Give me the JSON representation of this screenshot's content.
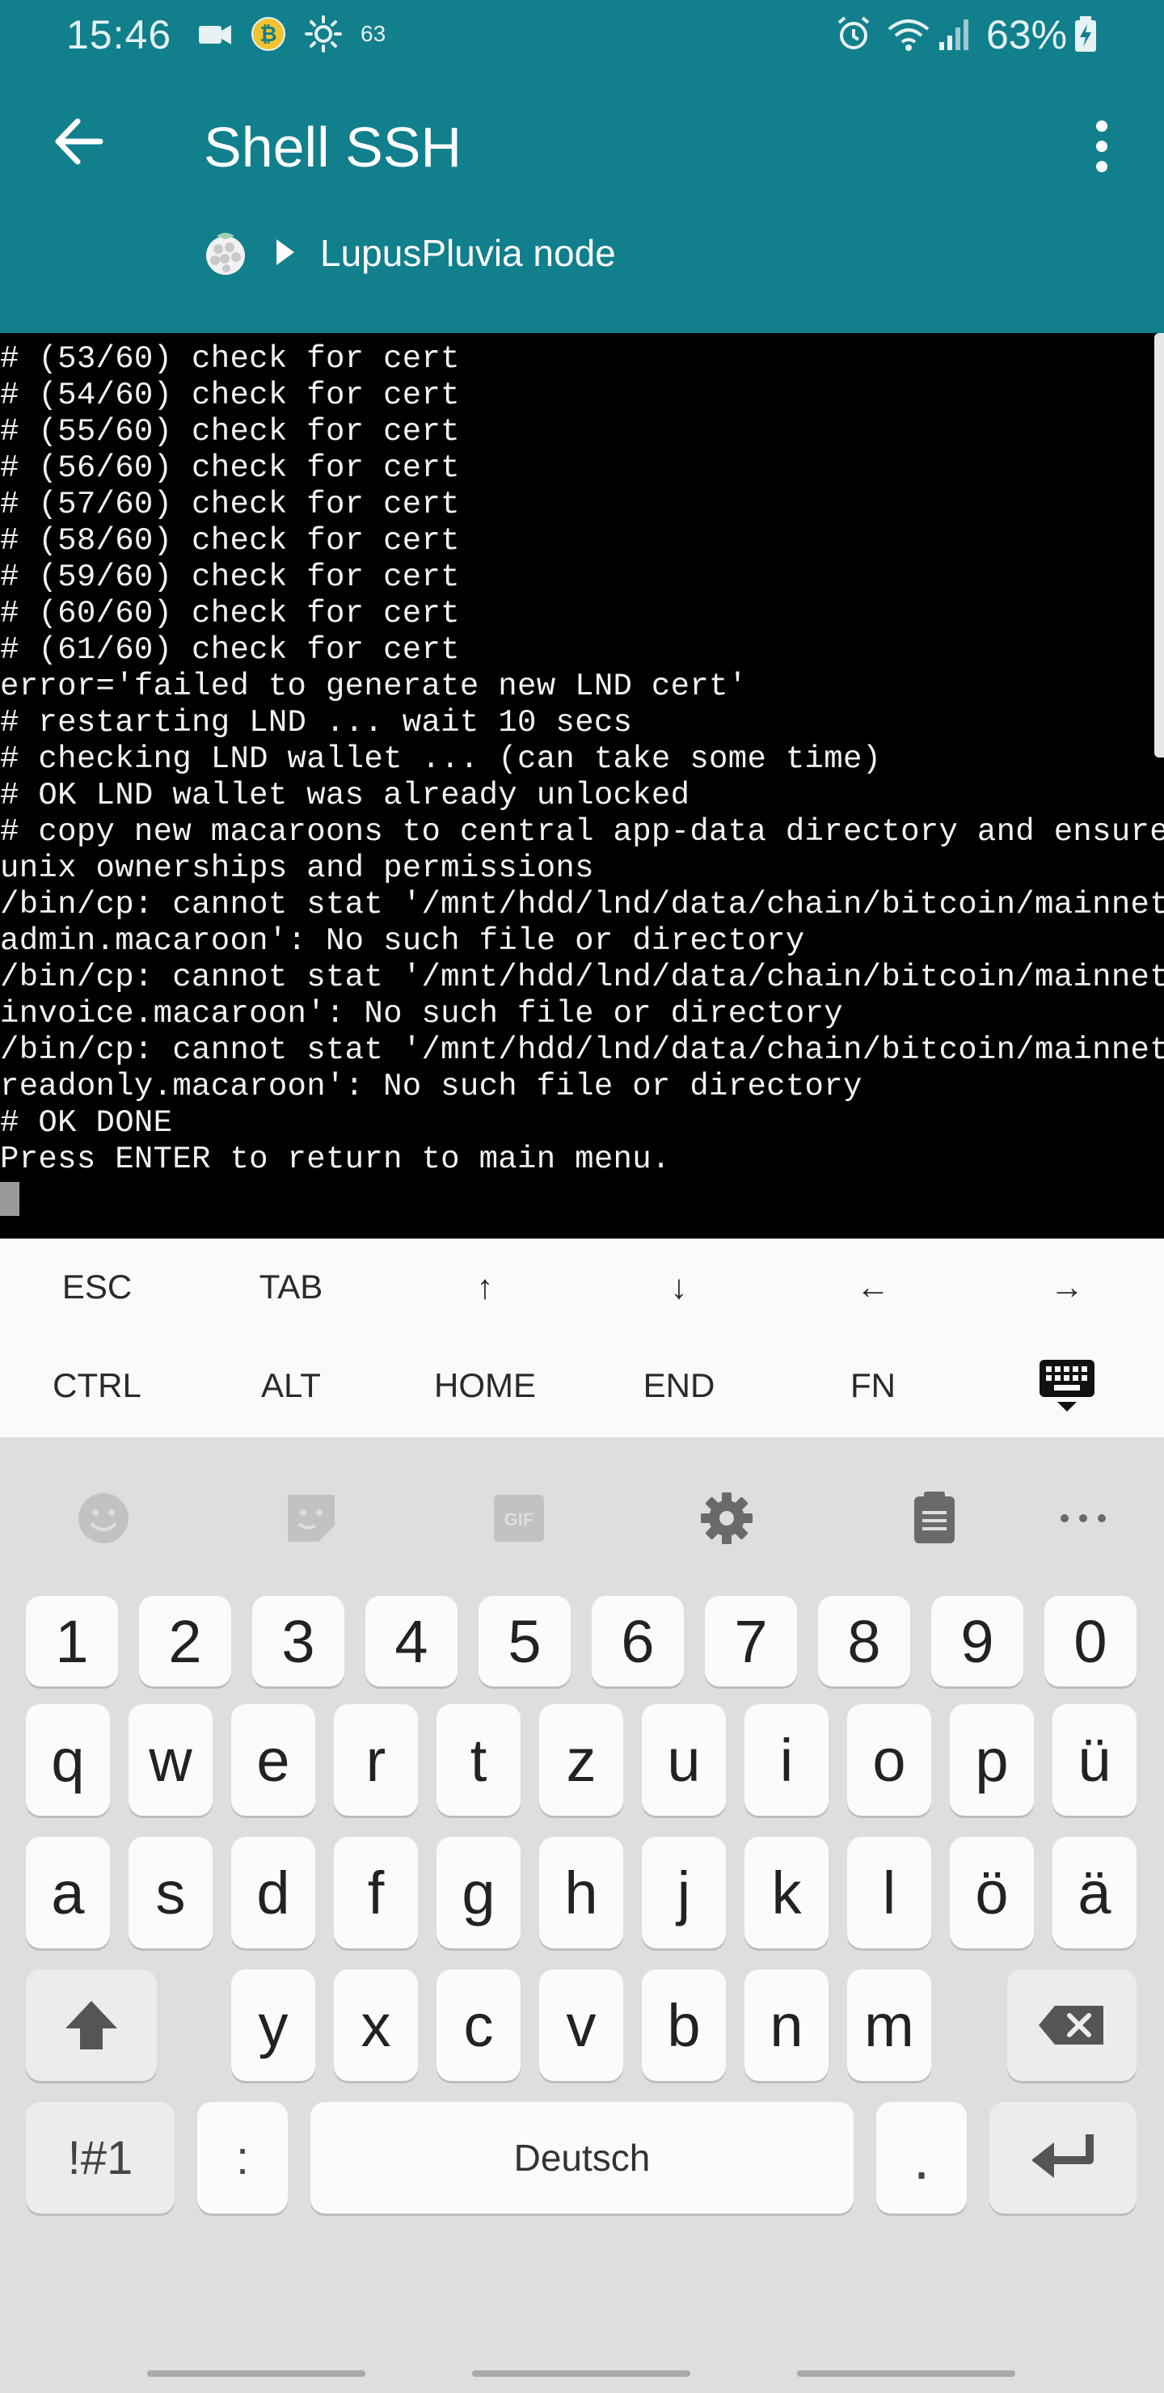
{
  "status_bar": {
    "time": "15:46",
    "extra_text": "63",
    "battery_percent": "63%",
    "icons": [
      "video-icon",
      "bitcoin-icon",
      "brightness-icon",
      "alarm-icon",
      "wifi-icon",
      "signal-icon",
      "battery-icon"
    ]
  },
  "app_bar": {
    "title": "Shell SSH",
    "back_icon": "arrow-left-icon",
    "menu_icon": "more-vert-icon"
  },
  "breadcrumb": {
    "icon": "raspberry-icon",
    "label": "LupusPluvia node"
  },
  "terminal": {
    "lines": [
      "# (53/60) check for cert",
      "# (54/60) check for cert",
      "# (55/60) check for cert",
      "# (56/60) check for cert",
      "# (57/60) check for cert",
      "# (58/60) check for cert",
      "# (59/60) check for cert",
      "# (60/60) check for cert",
      "# (61/60) check for cert",
      "error='failed to generate new LND cert'",
      "# restarting LND ... wait 10 secs",
      "# checking LND wallet ... (can take some time)",
      "# OK LND wallet was already unlocked",
      "# copy new macaroons to central app-data directory and ensure",
      "unix ownerships and permissions",
      "/bin/cp: cannot stat '/mnt/hdd/lnd/data/chain/bitcoin/mainnet/",
      "admin.macaroon': No such file or directory",
      "/bin/cp: cannot stat '/mnt/hdd/lnd/data/chain/bitcoin/mainnet/",
      "invoice.macaroon': No such file or directory",
      "/bin/cp: cannot stat '/mnt/hdd/lnd/data/chain/bitcoin/mainnet/",
      "readonly.macaroon': No such file or directory",
      "# OK DONE",
      "Press ENTER to return to main menu."
    ]
  },
  "extra_keys": {
    "row1": [
      "ESC",
      "TAB",
      "↑",
      "↓",
      "←",
      "→"
    ],
    "row2": [
      "CTRL",
      "ALT",
      "HOME",
      "END",
      "FN"
    ],
    "keyboard_toggle_icon": "keyboard-icon"
  },
  "keyboard": {
    "toolbar_icons": [
      "emoji-icon",
      "sticker-icon",
      "gif-icon",
      "settings-icon",
      "clipboard-icon",
      "more-horiz-icon"
    ],
    "gif_label": "GIF",
    "number_row": [
      "1",
      "2",
      "3",
      "4",
      "5",
      "6",
      "7",
      "8",
      "9",
      "0"
    ],
    "row1": [
      "q",
      "w",
      "e",
      "r",
      "t",
      "z",
      "u",
      "i",
      "o",
      "p",
      "ü"
    ],
    "row2": [
      "a",
      "s",
      "d",
      "f",
      "g",
      "h",
      "j",
      "k",
      "l",
      "ö",
      "ä"
    ],
    "row3": [
      "y",
      "x",
      "c",
      "v",
      "b",
      "n",
      "m"
    ],
    "symbols_label": "!#1",
    "colon_label": ":",
    "space_label": "Deutsch",
    "period_label": ".",
    "shift_icon": "shift-icon",
    "backspace_icon": "backspace-icon",
    "enter_icon": "enter-icon"
  },
  "colors": {
    "header": "#117f8c",
    "terminal_bg": "#000000",
    "terminal_fg": "#f2f2f2"
  }
}
